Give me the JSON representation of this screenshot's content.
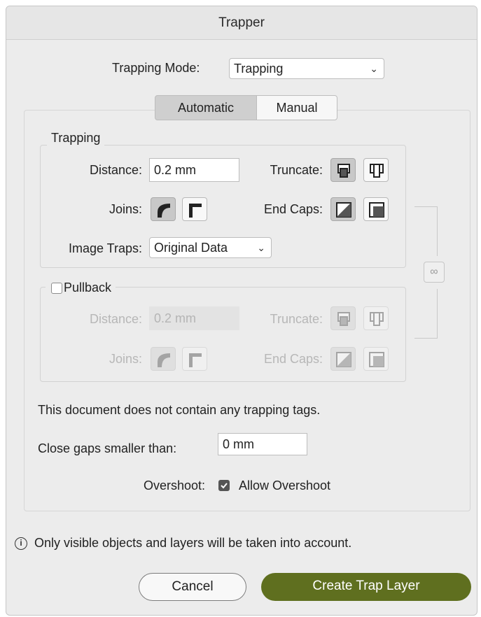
{
  "window": {
    "title": "Trapper"
  },
  "mode": {
    "label": "Trapping Mode:",
    "value": "Trapping"
  },
  "tabs": {
    "automatic": "Automatic",
    "manual": "Manual"
  },
  "trapping": {
    "legend": "Trapping",
    "distance_label": "Distance:",
    "distance_value": "0.2 mm",
    "truncate_label": "Truncate:",
    "joins_label": "Joins:",
    "endcaps_label": "End Caps:",
    "image_traps_label": "Image Traps:",
    "image_traps_value": "Original Data"
  },
  "pullback": {
    "legend": "Pullback",
    "checked": false,
    "distance_label": "Distance:",
    "distance_value": "0.2 mm",
    "truncate_label": "Truncate:",
    "joins_label": "Joins:",
    "endcaps_label": "End Caps:"
  },
  "status_text": "This document does not contain any trapping tags.",
  "close_gaps": {
    "label": "Close gaps smaller than:",
    "value": "0 mm"
  },
  "overshoot": {
    "label": "Overshoot:",
    "checkbox_label": "Allow Overshoot",
    "checked": true
  },
  "info_text": "Only visible objects and layers will be taken into account.",
  "buttons": {
    "cancel": "Cancel",
    "create": "Create Trap Layer"
  },
  "colors": {
    "primary_button": "#5f6f1f",
    "selected_segment": "#cfcfcf"
  }
}
